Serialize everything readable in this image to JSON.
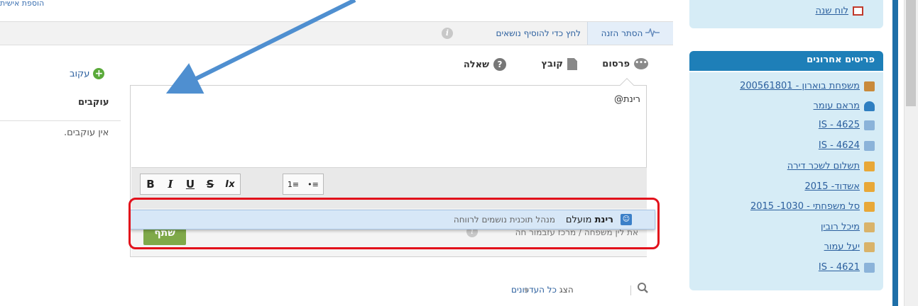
{
  "top_link": "הוספת אישית",
  "filter_bar": {
    "hide_feed": "הסתר הזנה",
    "add_topics": "לחץ כדי להוסיף נושאים"
  },
  "composer": {
    "tabs": [
      {
        "label": "פרסום",
        "icon": "chat-bubble-icon"
      },
      {
        "label": "קובץ",
        "icon": "file-icon"
      },
      {
        "label": "שאלה",
        "icon": "question-icon"
      }
    ],
    "text": "רינת@",
    "toolbar": {
      "bold": "B",
      "italic": "I",
      "underline": "U",
      "strike": "S",
      "clear": "Ix",
      "numbered": "1≡",
      "bulleted": "•≡"
    },
    "hint": "את לין משפחה / מרכז עזבמור חה",
    "share": "שתף"
  },
  "mention_suggestion": {
    "first_name": "רינת",
    "last_name": "מועלם",
    "role": "מנהל תוכנית נושמים לרווחה"
  },
  "feed_filter": {
    "show": "הצג",
    "all_updates": "כל העדכונים"
  },
  "followers": {
    "follow": "עקוב",
    "title": "עוקבים",
    "empty": "אין עוקבים."
  },
  "sidebar": {
    "calendar": "לוח שנה",
    "recent_title": "פריטים אחרונים",
    "recent_items": [
      {
        "label": "משפחת בוארון - 200561801",
        "icon": "box-icon",
        "color": "#c98a3b"
      },
      {
        "label": "מראם עומר",
        "icon": "person-icon",
        "color": "#2f7fc1"
      },
      {
        "label": "IS - 4625",
        "icon": "document-icon",
        "color": "#8bb3d9"
      },
      {
        "label": "IS - 4624",
        "icon": "document-icon",
        "color": "#8bb3d9"
      },
      {
        "label": "תשלום לשכר דירה",
        "icon": "package-icon",
        "color": "#e8a838"
      },
      {
        "label": "אשדוד- 2015",
        "icon": "package-icon",
        "color": "#e8a838"
      },
      {
        "label": "סל משפחתי - 1030- 2015",
        "icon": "package-icon",
        "color": "#e8a838"
      },
      {
        "label": "מיכל רובין",
        "icon": "contact-icon",
        "color": "#d9b36a"
      },
      {
        "label": "יעל עמור",
        "icon": "contact-icon",
        "color": "#d9b36a"
      },
      {
        "label": "IS - 4621",
        "icon": "document-icon",
        "color": "#8bb3d9"
      }
    ]
  },
  "colors": {
    "link": "#2b5f9e",
    "sidebar_header": "#1e7fb8",
    "sidebar_bg": "#d6ecf6",
    "highlight_frame": "#e2101b",
    "arrow": "#4f8fd0",
    "share_button": "#7fa949"
  }
}
